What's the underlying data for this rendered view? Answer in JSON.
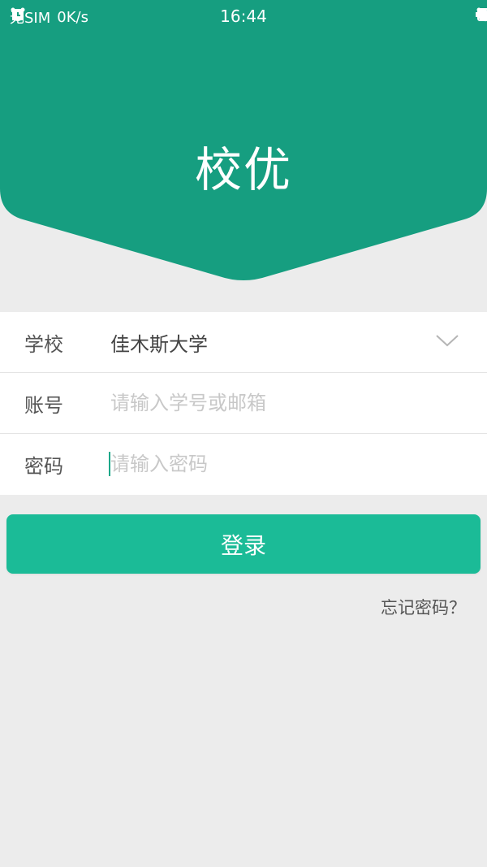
{
  "status_bar": {
    "carrier": "无SIM",
    "network_speed": "0K/s",
    "time": "16:44",
    "battery_icon": "battery-icon",
    "wifi_icon": "wifi-icon",
    "alarm_icon": "alarm-icon"
  },
  "header": {
    "title": "校优",
    "color": "#169e80"
  },
  "form": {
    "school_label": "学校",
    "school_value": "佳木斯大学",
    "account_label": "账号",
    "account_placeholder": "请输入学号或邮箱",
    "password_label": "密码",
    "password_placeholder": "请输入密码"
  },
  "actions": {
    "login_label": "登录",
    "forgot_label": "忘记密码？",
    "login_color": "#1bbb97"
  }
}
